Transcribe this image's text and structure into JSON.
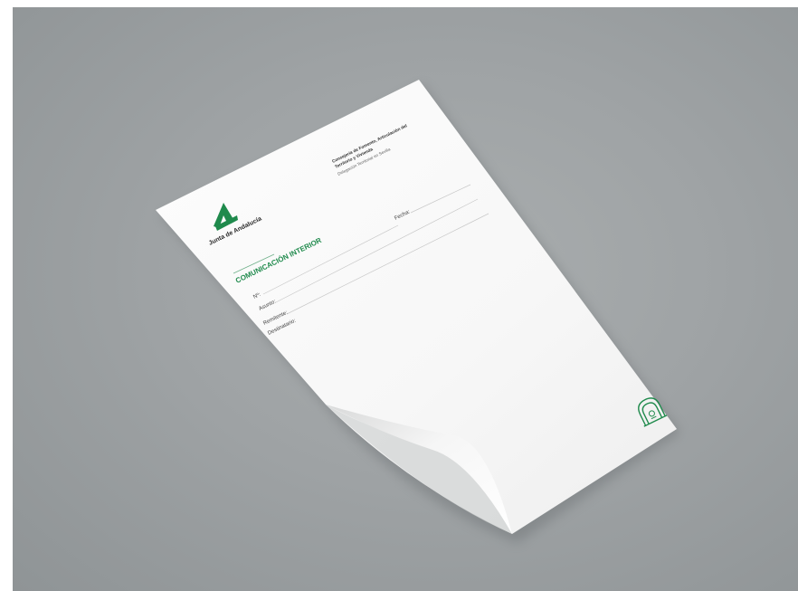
{
  "document": {
    "brand_name": "Junta de Andalucía",
    "department_line1": "Consejería de Fomento, Articulación del",
    "department_line2": "Territorio y Vivienda",
    "delegation": "Delegación Territorial en Sevilla",
    "title": "COMUNICACIÓN INTERIOR",
    "fields": {
      "numero": "Nº:",
      "fecha": "Fecha:",
      "asunto": "Asunto:",
      "remitente": "Remitente:",
      "destinatario": "Destinatario:"
    }
  },
  "colors": {
    "brand_green": "#1f8a4c",
    "background": "#9ea2a4",
    "paper": "#fafafa"
  },
  "icons": {
    "logo": "junta-andalucia-a-logo-icon",
    "seal": "andalucia-arch-seal-icon"
  }
}
